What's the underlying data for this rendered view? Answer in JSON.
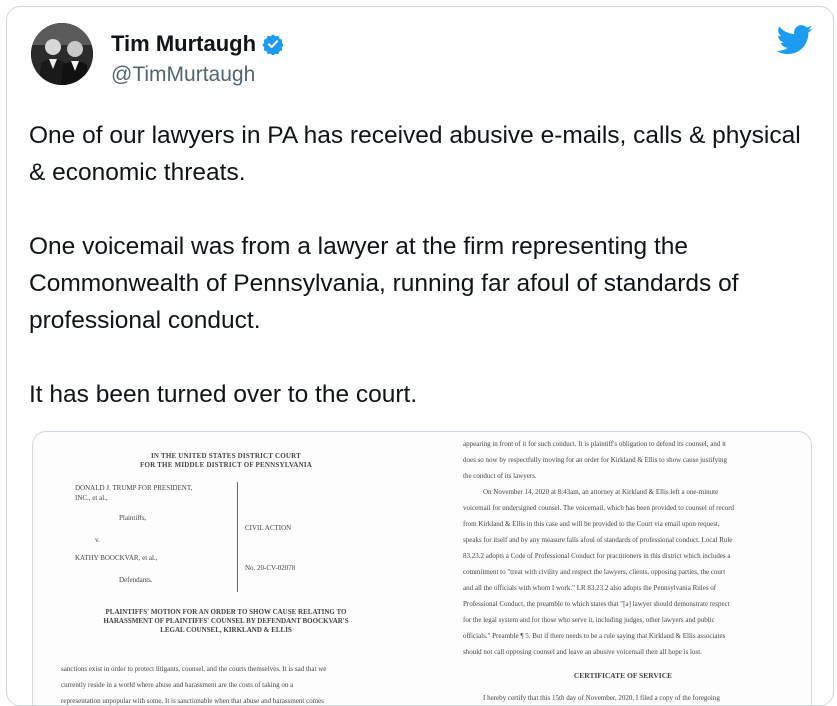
{
  "tweet": {
    "author_name": "Tim Murtaugh",
    "handle": "@TimMurtaugh",
    "paragraphs": [
      "One of our lawyers in PA has received abusive e-mails, calls & physical & economic threats.",
      "One voicemail was from a lawyer at the firm representing the Commonwealth of Pennsylvania, running far afoul of standards of professional conduct.",
      "It has been turned over to the court."
    ]
  },
  "icons": {
    "verified": "verified-badge-icon",
    "brand": "twitter-bird-icon"
  },
  "colors": {
    "brand_blue": "#1d9bf0",
    "text": "#0f1419",
    "secondary": "#536471"
  },
  "document": {
    "court_line1": "IN THE UNITED STATES DISTRICT COURT",
    "court_line2": "FOR THE MIDDLE DISTRICT OF PENNSYLVANIA",
    "plaintiff_1": "DONALD J. TRUMP FOR PRESIDENT,",
    "plaintiff_2": "INC., et al.,",
    "plaintiffs_label": "Plaintiffs,",
    "versus": "v.",
    "civil_action": "CIVIL ACTION",
    "defendant": "KATHY BOOCKVAR, et al.,",
    "case_no": "No. 20-CV-02078",
    "defendants_label": "Defendants.",
    "motion_1": "PLAINTIFFS' MOTION FOR AN ORDER TO SHOW CAUSE RELATING TO",
    "motion_2": "HARASSMENT OF PLAINTIFFS' COUNSEL BY DEFENDANT BOOCKVAR'S",
    "motion_3": "LEGAL COUNSEL, KIRKLAND & ELLIS",
    "left_body": [
      "sanctions exist in order to protect litigants, counsel, and the courts themselves. It is sad that we",
      "currently reside in a world where abuse and harassment are the costs of taking on a",
      "representation unpopular with some. It is sanctionable when that abuse and harassment comes"
    ],
    "right_para1": [
      "appearing in front of it for such conduct. It is plaintiff's obligation to defend its counsel, and it",
      "does so now by respectfully moving for an order for Kirkland & Ellis to show cause justifying",
      "the conduct of its lawyers."
    ],
    "right_para2": [
      "On November 14, 2020 at 8:43am, an attorney at Kirkland & Ellis left a one-minute",
      "voicemail for undersigned counsel. The voicemail, which has been provided to counsel of record",
      "from Kirkland & Ellis in this case and will be provided to the Court via email upon request,",
      "speaks for itself and by any measure falls afoul of standards of professional conduct. Local Rule",
      "83.23.2 adopts a Code of Professional Conduct for practitioners in this district which includes a",
      "commitment to \"treat with civility and respect the lawyers, clients, opposing parties, the court",
      "and all the officials with whom I work.\" LR 83.23.2 also adopts the Pennsylvania Rules of",
      "Professional Conduct, the preamble to which states that \"[a] lawyer should demonstrate respect",
      "for the legal system and for those who serve it, including judges, other lawyers and public",
      "officials.\" Preamble ¶ 5. But if there needs to be a rule saying that Kirkland & Ellis associates",
      "should not call opposing counsel and leave an abusive voicemail then all hope is lost."
    ],
    "cert_heading": "CERTIFICATE OF SERVICE",
    "cert_line": "I hereby certify that this 15th day of November, 2020, I filed a copy of the foregoing"
  }
}
